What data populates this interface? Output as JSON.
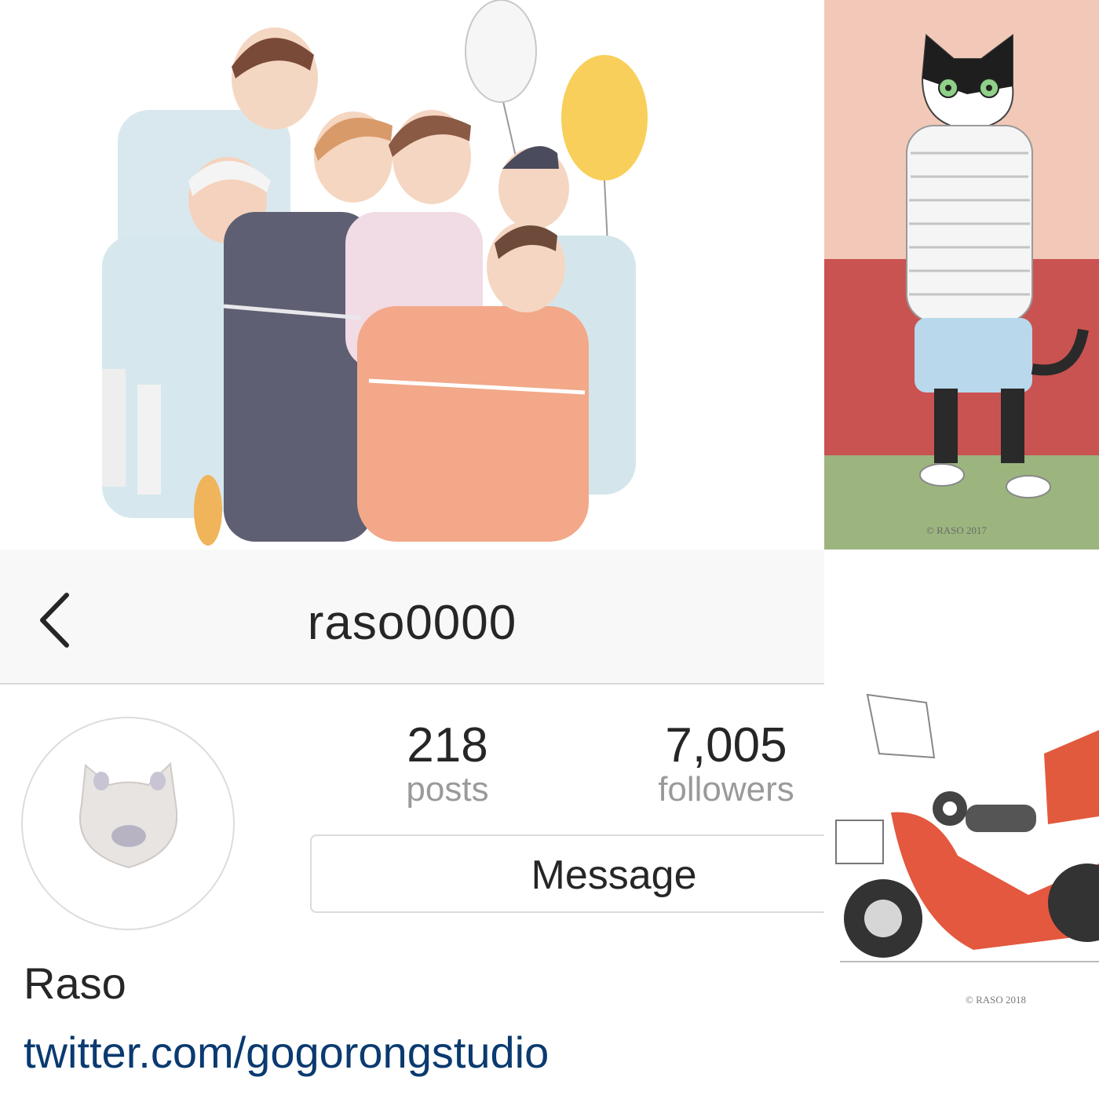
{
  "header": {
    "username": "raso0000"
  },
  "profile": {
    "posts_count": "218",
    "posts_label": "posts",
    "followers_count": "7,005",
    "followers_label": "followers",
    "message_label": "Message",
    "full_name": "Raso",
    "website": "twitter.com/gogorongstudio"
  },
  "icons": [
    "back-chevron-icon"
  ],
  "colors": {
    "text": "#262626",
    "secondary_text": "#9a9a9a",
    "link": "#0a3a70",
    "nav_background": "#f8f8f8",
    "border": "#dbdbdb"
  },
  "artwork": {
    "cat_signature": "© RASO 2017",
    "scooter_signature": "© RASO 2018"
  }
}
